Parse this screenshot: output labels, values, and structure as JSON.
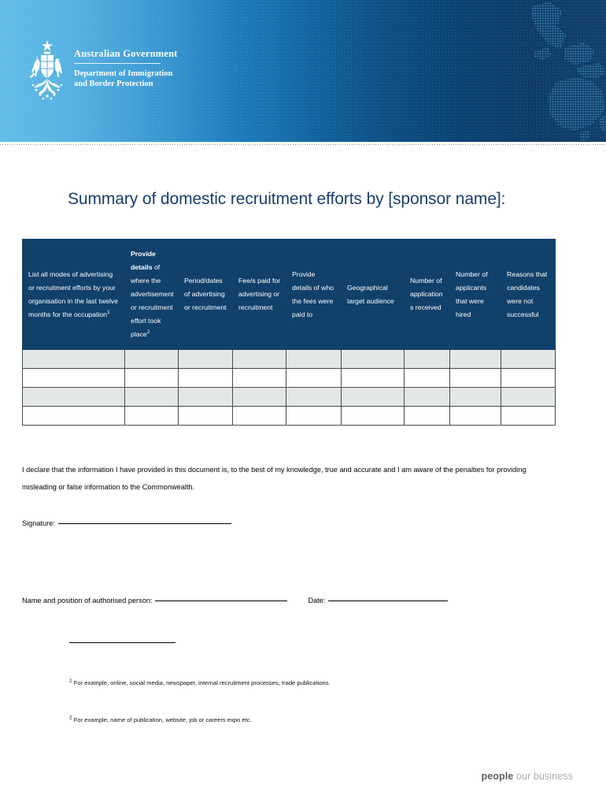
{
  "header": {
    "crest_icon": "australian-coat-of-arms-icon",
    "map_icon": "dotted-australia-map-icon",
    "government_line": "Australian Government",
    "department_line_1": "Department of Immigration",
    "department_line_2": "and Border Protection",
    "gradient_light": "#63bce8",
    "gradient_dark": "#11406b"
  },
  "document": {
    "title": "Summary of domestic recruitment efforts by [sponsor name]:",
    "title_color": "#1a3d6e"
  },
  "table": {
    "header_background": "#11406b",
    "row_shaded_background": "#e4e7e7",
    "columns": [
      {
        "id": "modes-of-advertising",
        "text_prefix": "List all  modes of advertising or recruitment efforts by your organisation in the last twelve months for the occupation",
        "superscript": "1",
        "bold_lead": ""
      },
      {
        "id": "details-of-where",
        "bold_lead": "Provide details",
        "text_prefix": " of where the advertisement or recruitment effort took place",
        "superscript": "2"
      },
      {
        "id": "period-dates",
        "bold_lead": "",
        "text_prefix": "Period/dates of advertising or recruitment",
        "superscript": ""
      },
      {
        "id": "fees-paid",
        "bold_lead": "",
        "text_prefix": "Fee/s paid for advertising or recruitment",
        "superscript": ""
      },
      {
        "id": "who-fees-paid-to",
        "bold_lead": "",
        "text_prefix": "Provide details of who the fees were paid to",
        "superscript": ""
      },
      {
        "id": "geographical-target-audience",
        "bold_lead": "",
        "text_prefix": "Geographical target audience",
        "superscript": ""
      },
      {
        "id": "applications-received",
        "bold_lead": "",
        "text_prefix": "Number of application s received",
        "superscript": ""
      },
      {
        "id": "applicants-hired",
        "bold_lead": "",
        "text_prefix": "Number of applicants that were hired",
        "superscript": ""
      },
      {
        "id": "reasons-not-successful",
        "bold_lead": "",
        "text_prefix": "Reasons that candidates were not successful",
        "superscript": ""
      }
    ],
    "rows": [
      [
        "",
        "",
        "",
        "",
        "",
        "",
        "",
        "",
        ""
      ],
      [
        "",
        "",
        "",
        "",
        "",
        "",
        "",
        "",
        ""
      ],
      [
        "",
        "",
        "",
        "",
        "",
        "",
        "",
        "",
        ""
      ],
      [
        "",
        "",
        "",
        "",
        "",
        "",
        "",
        "",
        ""
      ]
    ]
  },
  "declaration": {
    "text": "I declare that the information I have provided in this document is, to the best of my knowledge, true and accurate and I am aware of the penalties for providing misleading or false information to the Commonwealth."
  },
  "signature": {
    "label": "Signature:",
    "value": ""
  },
  "authorised_person": {
    "label": "Name and position of authorised person:",
    "value": "",
    "date_label": "Date:",
    "date_value": ""
  },
  "footnotes": [
    {
      "marker": "1",
      "text": "For example, online, social media, newspaper, internal recruitment processes, trade publications."
    },
    {
      "marker": "2",
      "text": "For example, name of publication, website, job or careers expo etc."
    }
  ],
  "footer": {
    "tagline_bold": "people",
    "tagline_rest": " our business"
  }
}
